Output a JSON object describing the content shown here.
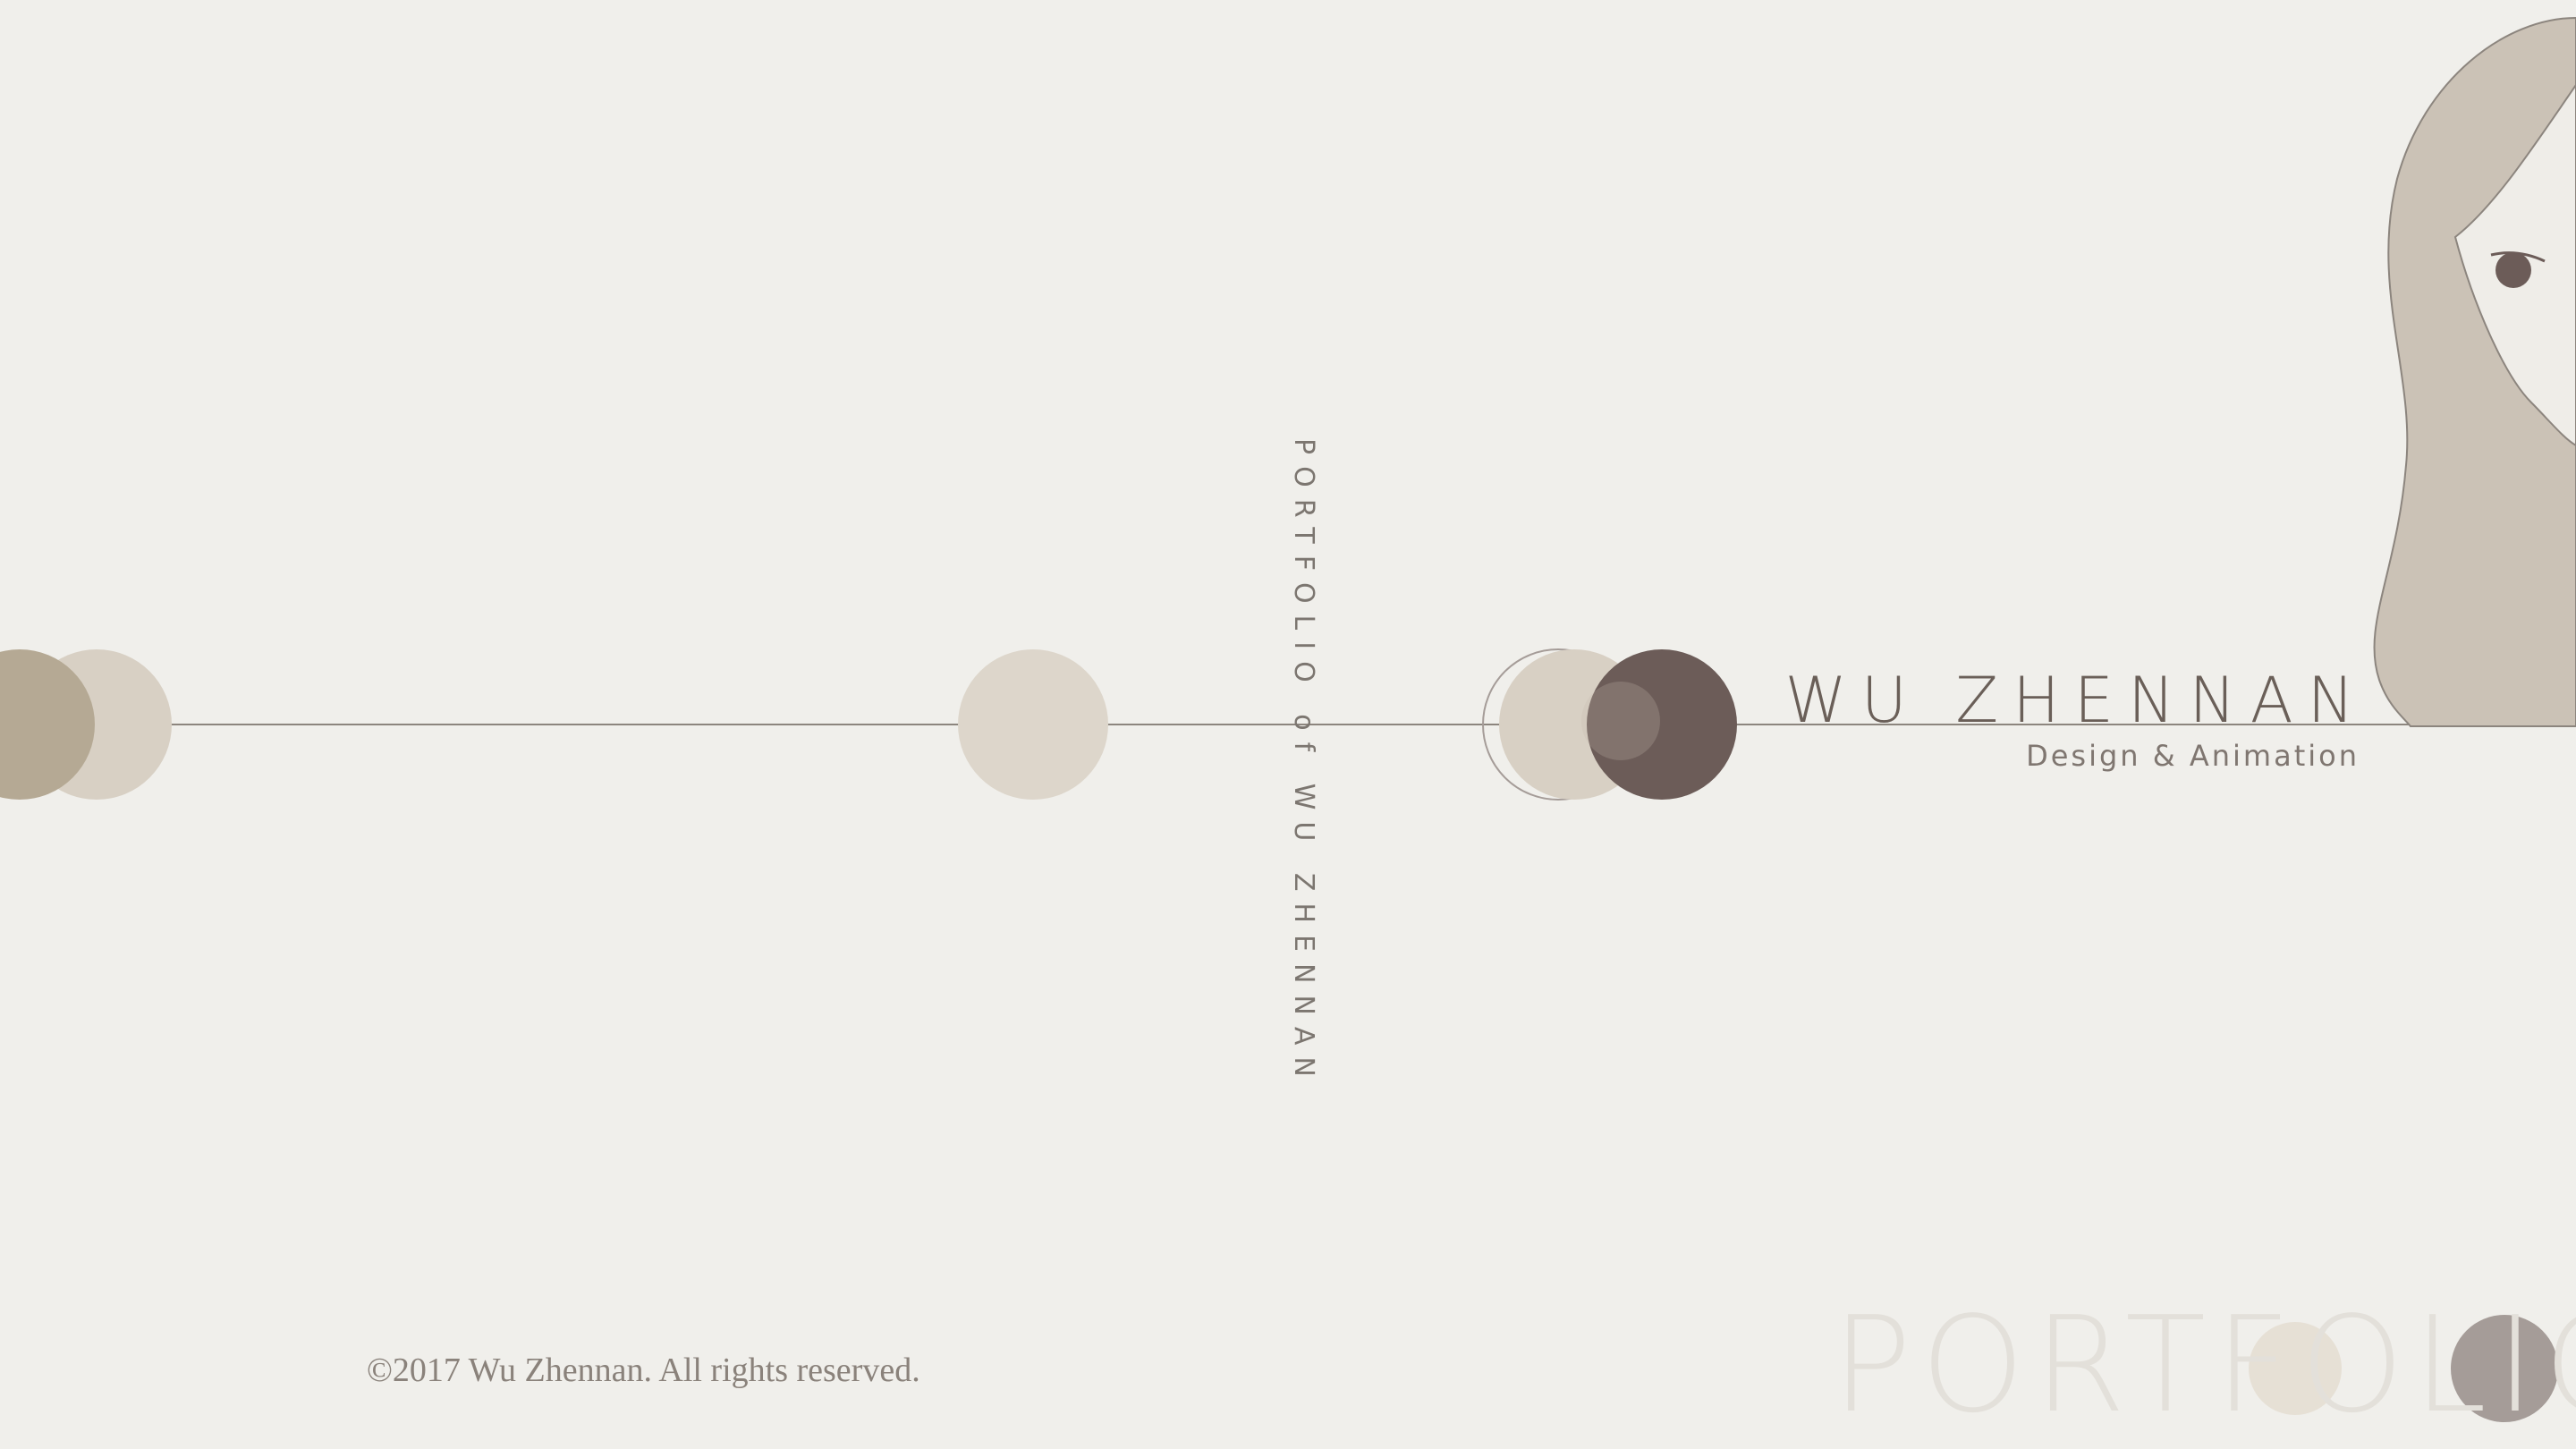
{
  "cover": {
    "spine_title": "PORTFOLIO of WU ZHENNAN",
    "name": "WU ZHENNAN",
    "subtitle": "Design & Animation",
    "copyright": "©2017 Wu Zhennan. All rights reserved.",
    "watermark": "PORTFOLIO"
  },
  "colors": {
    "background": "#f0efeb",
    "line": "#8c857e",
    "circle_tan": "#b5a994",
    "circle_light": "#d8d0c4",
    "circle_dark": "#6c5c58",
    "circle_grey": "#a59c98",
    "illustration_hair": "#c9c0b5"
  }
}
